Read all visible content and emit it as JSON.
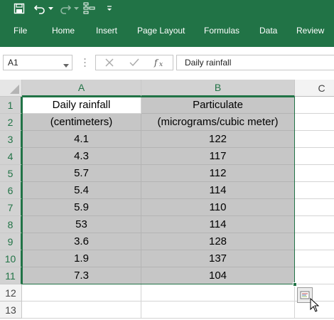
{
  "ribbon": {
    "tabs": [
      "File",
      "Home",
      "Insert",
      "Page Layout",
      "Formulas",
      "Data",
      "Review"
    ]
  },
  "formula_bar": {
    "name_box": "A1",
    "formula": "Daily rainfall"
  },
  "grid": {
    "columns": [
      "A",
      "B",
      "C"
    ],
    "rows": [
      "1",
      "2",
      "3",
      "4",
      "5",
      "6",
      "7",
      "8",
      "9",
      "10",
      "11",
      "12",
      "13"
    ],
    "cells": [
      [
        "Daily rainfall",
        "Particulate"
      ],
      [
        "(centimeters)",
        "(micrograms/cubic meter)"
      ],
      [
        "4.1",
        "122"
      ],
      [
        "4.3",
        "117"
      ],
      [
        "5.7",
        "112"
      ],
      [
        "5.4",
        "114"
      ],
      [
        "5.9",
        "110"
      ],
      [
        "53",
        "114"
      ],
      [
        "3.6",
        "128"
      ],
      [
        "1.9",
        "137"
      ],
      [
        "7.3",
        "104"
      ]
    ]
  },
  "colors": {
    "accent": "#217346",
    "selection_fill": "#c6c6c6"
  }
}
